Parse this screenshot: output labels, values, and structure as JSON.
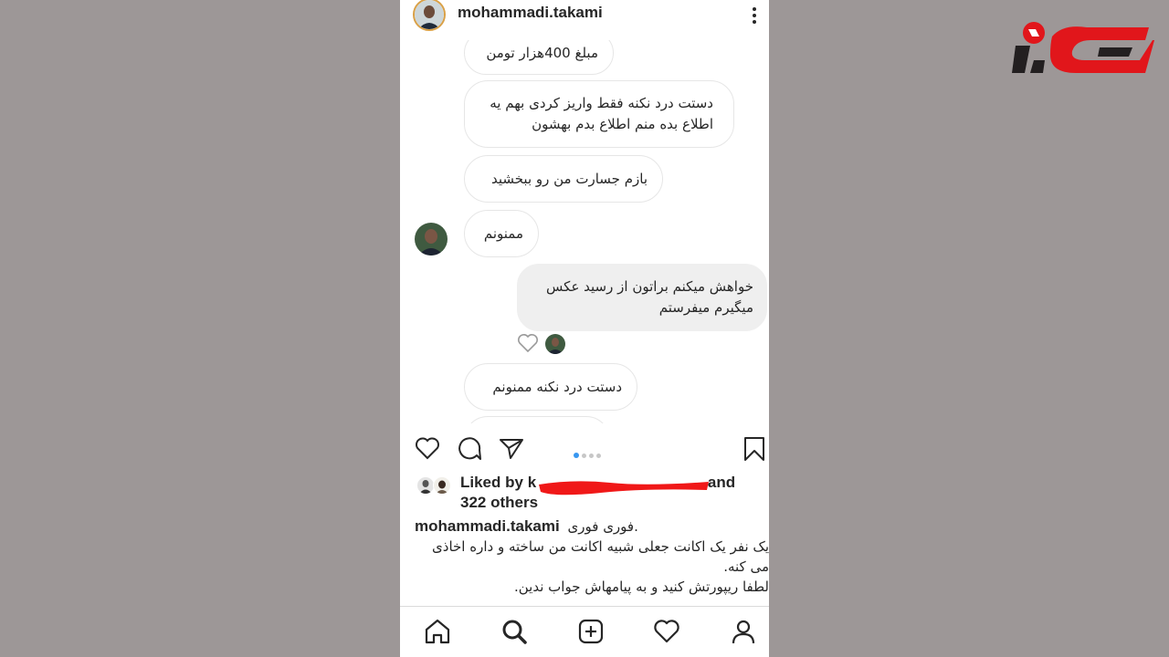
{
  "header": {
    "username": "mohammadi.takami",
    "more_icon": "more-vertical-icon"
  },
  "messages": [
    {
      "text": "مبلغ 400هزار تومن",
      "sender": "other"
    },
    {
      "text": "دستت درد نکنه فقط واریز کردی بهم یه اطلاع بده منم اطلاع بدم بهشون",
      "sender": "other"
    },
    {
      "text": "بازم جسارت من رو ببخشید",
      "sender": "other"
    },
    {
      "text": "ممنونم",
      "sender": "other"
    },
    {
      "text": "خواهش میکنم براتون از رسید عکس میگیرم میفرستم",
      "sender": "me"
    },
    {
      "text": "دستت درد نکنه ممنونم",
      "sender": "other"
    }
  ],
  "actions": {
    "like_icon": "heart-icon",
    "comment_icon": "comment-icon",
    "share_icon": "paper-plane-icon",
    "save_icon": "bookmark-icon",
    "carousel_pages": 4,
    "carousel_active": 1
  },
  "likes": {
    "prefix": "Liked by",
    "user_partial": "k",
    "and": "and",
    "others": "322 others",
    "redaction_color": "#f01818"
  },
  "caption": {
    "username": "mohammadi.takami",
    "line1": "فوری فوری.",
    "line2": "یک نفر یک اکانت جعلی شبیه اکانت من ساخته و داره اخاذی",
    "line3": "می کنه.",
    "line4": "لطفا ریپورتش کنید و به پیامهاش جواب ندین."
  },
  "nav": [
    "home-icon",
    "search-icon",
    "new-post-icon",
    "activity-heart-icon",
    "profile-icon"
  ],
  "colors": {
    "background": "#9d9797",
    "story_ring": "#d9a046",
    "logo_red": "#e1161b",
    "logo_dark": "#231f20"
  }
}
